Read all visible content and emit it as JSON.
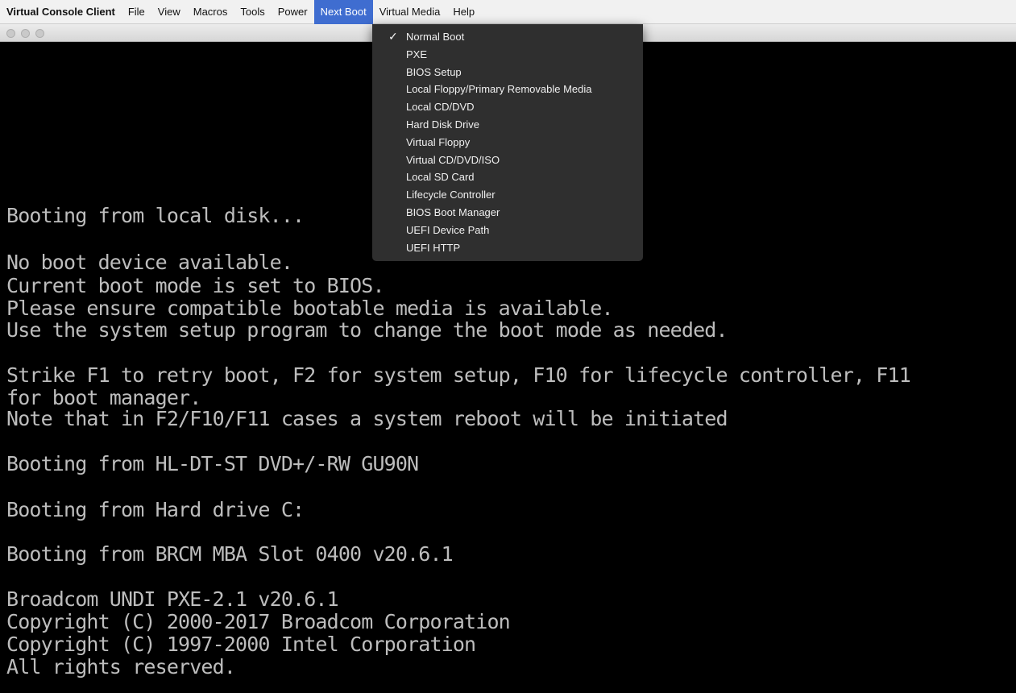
{
  "menubar": {
    "app_name": "Virtual Console Client",
    "items": [
      {
        "label": "File"
      },
      {
        "label": "View"
      },
      {
        "label": "Macros"
      },
      {
        "label": "Tools"
      },
      {
        "label": "Power"
      },
      {
        "label": "Next Boot"
      },
      {
        "label": "Virtual Media"
      },
      {
        "label": "Help"
      }
    ],
    "active_index": 5
  },
  "next_boot_menu": {
    "check_glyph": "✓",
    "items": [
      {
        "label": "Normal Boot",
        "checked": true
      },
      {
        "label": "PXE",
        "checked": false
      },
      {
        "label": "BIOS Setup",
        "checked": false
      },
      {
        "label": "Local Floppy/Primary Removable Media",
        "checked": false
      },
      {
        "label": "Local CD/DVD",
        "checked": false
      },
      {
        "label": "Hard Disk Drive",
        "checked": false
      },
      {
        "label": "Virtual Floppy",
        "checked": false
      },
      {
        "label": "Virtual CD/DVD/ISO",
        "checked": false
      },
      {
        "label": "Local SD Card",
        "checked": false
      },
      {
        "label": "Lifecycle Controller",
        "checked": false
      },
      {
        "label": "BIOS Boot Manager",
        "checked": false
      },
      {
        "label": "UEFI Device Path",
        "checked": false
      },
      {
        "label": "UEFI HTTP",
        "checked": false
      }
    ]
  },
  "console": {
    "lines": [
      "Booting from local disk...",
      "No boot device available.",
      "Current boot mode is set to BIOS.",
      "Please ensure compatible bootable media is available.",
      "Use the system setup program to change the boot mode as needed.",
      "Strike F1 to retry boot, F2 for system setup, F10 for lifecycle controller, F11",
      "for boot manager.",
      "Note that in F2/F10/F11 cases a system reboot will be initiated",
      "Booting from HL-DT-ST DVD+/-RW GU90N",
      "Booting from Hard drive C:",
      "Booting from BRCM MBA Slot 0400 v20.6.1",
      "Broadcom UNDI PXE-2.1 v20.6.1",
      "Copyright (C) 2000-2017 Broadcom Corporation",
      "Copyright (C) 1997-2000 Intel Corporation",
      "All rights reserved."
    ]
  },
  "colors": {
    "console_bg": "#000000",
    "console_text": "#bdbdbd",
    "menu_highlight": "#3f6dd0",
    "dropdown_bg": "#2f2f2f"
  }
}
